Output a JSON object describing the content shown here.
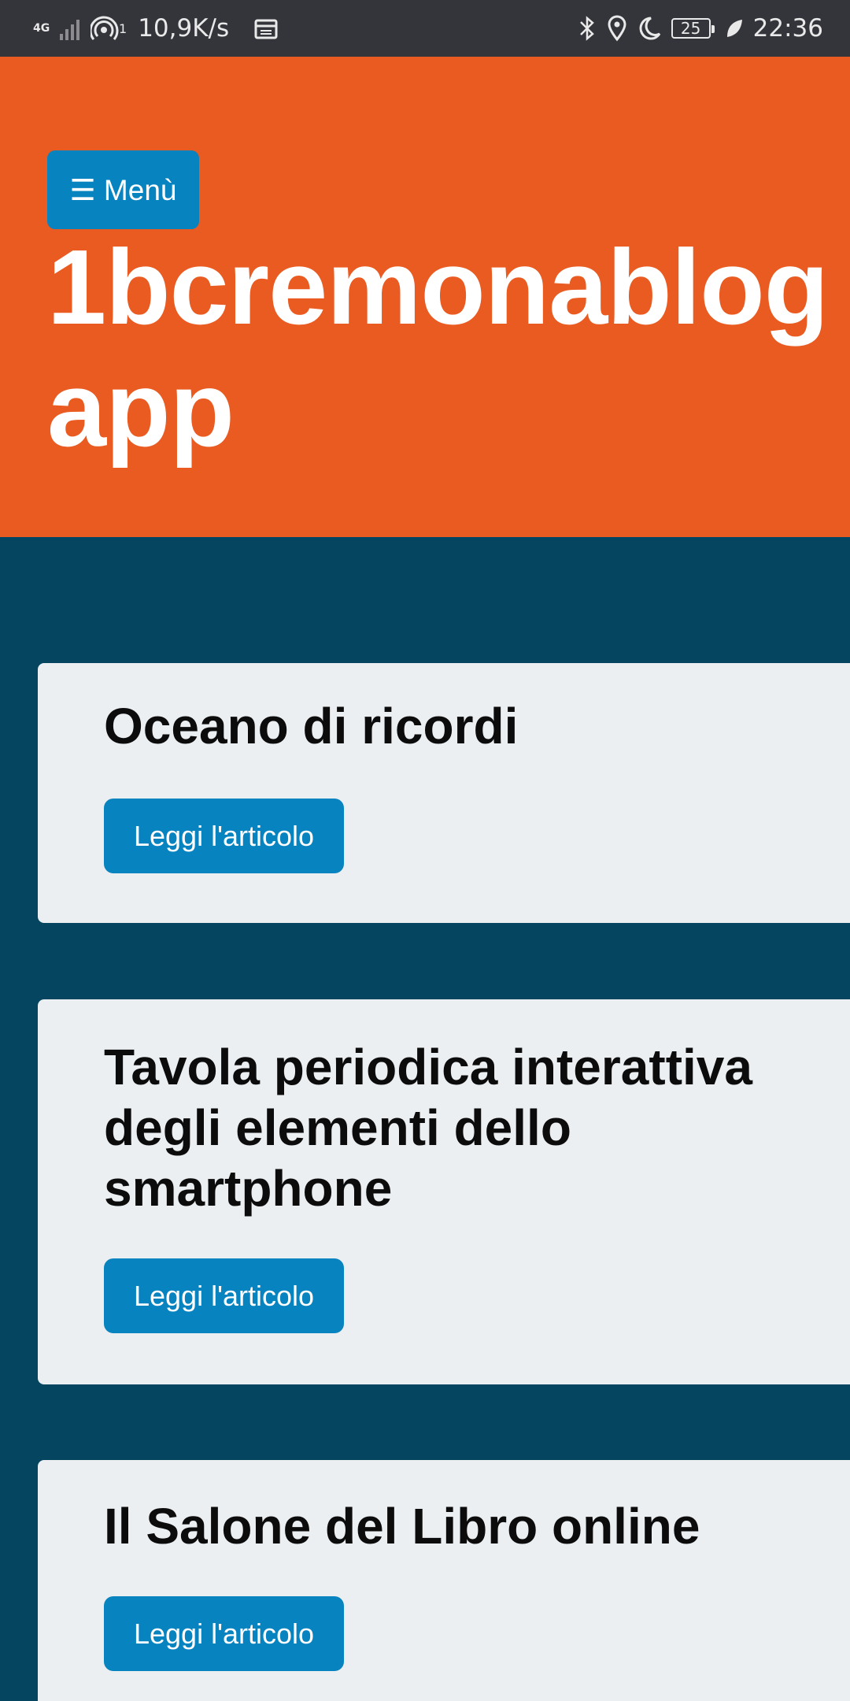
{
  "status_bar": {
    "network_type": "4G",
    "hotspot_count": "1",
    "speed": "10,9K/s",
    "battery": "25",
    "time": "22:36",
    "icons": [
      "signal-icon",
      "hotspot-icon",
      "calendar-icon",
      "bluetooth-icon",
      "location-icon",
      "moon-icon",
      "battery-icon",
      "leaf-icon"
    ]
  },
  "header": {
    "menu_label": "☰ Menù",
    "site_title": "1bcremonablog app",
    "background_color": "#ea5b22"
  },
  "articles": [
    {
      "title": "Oceano di ricordi",
      "button_label": "Leggi l'articolo"
    },
    {
      "title": "Tavola periodica interattiva degli elementi dello smartphone",
      "button_label": "Leggi l'articolo"
    },
    {
      "title": "Il Salone del Libro online",
      "button_label": "Leggi l'articolo"
    }
  ],
  "colors": {
    "page_background": "#064560",
    "accent_button": "#0783c0",
    "card_background": "#ebeff2"
  }
}
